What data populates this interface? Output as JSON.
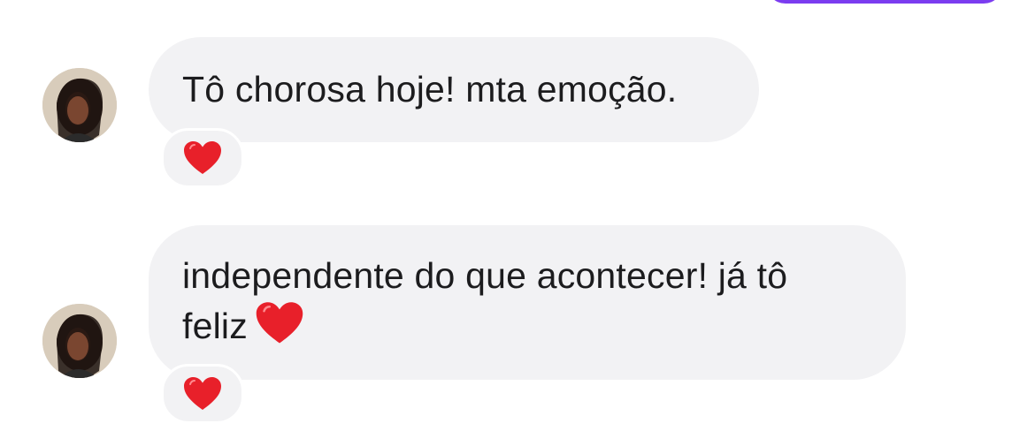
{
  "conversation": {
    "sent_bubble_color": "#7b3cf0",
    "received_bubble_color": "#f2f2f4",
    "messages": [
      {
        "text": "Tô chorosa hoje! mta emoção.",
        "reaction": "red-heart-icon"
      },
      {
        "text_line1": "independente do que acontecer! já tô",
        "text_line2": "feliz",
        "inline_emoji": "red-heart-icon",
        "reaction": "red-heart-icon"
      }
    ]
  }
}
